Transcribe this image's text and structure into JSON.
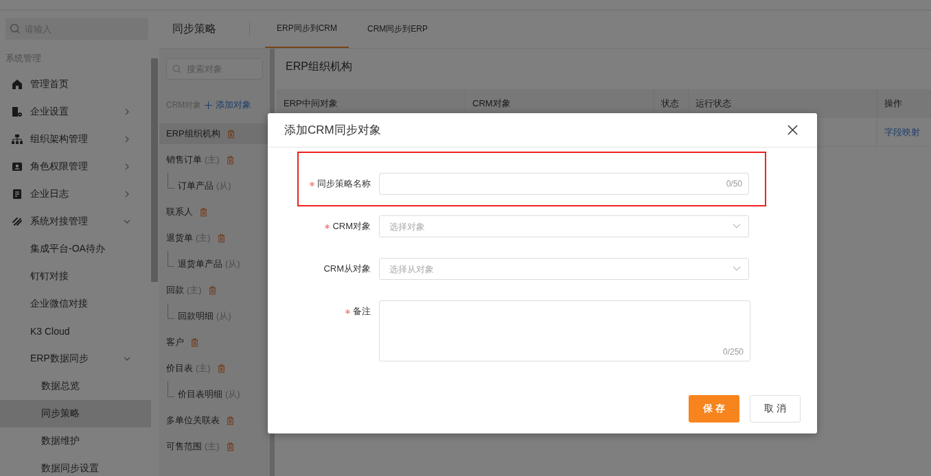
{
  "sidebar": {
    "search": {
      "placeholder": "请输入"
    },
    "section": "系统管理",
    "items": [
      {
        "label": "管理首页",
        "selected": false
      },
      {
        "label": "企业设置",
        "selected": false,
        "expanded": false
      },
      {
        "label": "组织架构管理",
        "selected": false,
        "expanded": false
      },
      {
        "label": "角色权限管理",
        "selected": false,
        "expanded": false
      },
      {
        "label": "企业日志",
        "selected": false,
        "expanded": false
      },
      {
        "label": "系统对接管理",
        "selected": false,
        "expanded": true,
        "children": [
          {
            "label": "集成平台-OA待办",
            "selected": false
          },
          {
            "label": "钉钉对接",
            "selected": false
          },
          {
            "label": "企业微信对接",
            "selected": false
          },
          {
            "label": "K3 Cloud",
            "selected": false
          },
          {
            "label": "ERP数据同步",
            "selected": false,
            "expanded": true,
            "children": [
              {
                "label": "数据总览",
                "selected": false
              },
              {
                "label": "同步策略",
                "selected": true
              },
              {
                "label": "数据维护",
                "selected": false
              },
              {
                "label": "数据同步设置",
                "selected": false
              }
            ]
          }
        ]
      }
    ]
  },
  "page_title": "同步策略",
  "tabs": [
    {
      "label": "ERP同步到CRM",
      "selected": true
    },
    {
      "label": "CRM同步到ERP",
      "selected": false
    }
  ],
  "object_panel": {
    "search": {
      "placeholder": "搜索对象"
    },
    "heading": "CRM对象",
    "add_link": "添加对象",
    "objects": [
      {
        "name": "ERP组织机构",
        "selected": true
      },
      {
        "name": "销售订单",
        "tag": "(主)",
        "selected": false,
        "children": [
          {
            "name": "订单产品",
            "tag": "(从)",
            "selected": false
          }
        ]
      },
      {
        "name": "联系人",
        "selected": false
      },
      {
        "name": "退货单",
        "tag": "(主)",
        "selected": false,
        "children": [
          {
            "name": "退货单产品",
            "tag": "(从)",
            "selected": false
          }
        ]
      },
      {
        "name": "回款",
        "tag": "(主)",
        "selected": false,
        "children": [
          {
            "name": "回款明细",
            "tag": "(从)",
            "selected": false
          }
        ]
      },
      {
        "name": "客户",
        "selected": false
      },
      {
        "name": "价目表",
        "tag": "(主)",
        "selected": false,
        "children": [
          {
            "name": "价目表明细",
            "tag": "(从)",
            "selected": false
          }
        ]
      },
      {
        "name": "多单位关联表",
        "selected": false
      },
      {
        "name": "可售范围",
        "tag": "(主)",
        "selected": false
      }
    ]
  },
  "content": {
    "title": "ERP组织机构",
    "table": {
      "columns": [
        "ERP中间对象",
        "CRM对象",
        "状态",
        "运行状态",
        "操作"
      ],
      "rows": [
        {
          "actions": [
            "字段映射"
          ]
        }
      ]
    }
  },
  "modal": {
    "title": "添加CRM同步对象",
    "fields": [
      {
        "kind": "text",
        "label": "同步策略名称",
        "required": true,
        "counter": "0/50",
        "highlighted": true
      },
      {
        "kind": "select",
        "label": "CRM对象",
        "required": true,
        "placeholder": "选择对象"
      },
      {
        "kind": "select",
        "label": "CRM从对象",
        "placeholder": "选择从对象"
      },
      {
        "kind": "textarea",
        "label": "备注",
        "required": true,
        "counter": "0/250"
      }
    ],
    "buttons": [
      {
        "label": "保 存",
        "kind": "primary"
      },
      {
        "label": "取 消",
        "kind": "default"
      }
    ]
  }
}
